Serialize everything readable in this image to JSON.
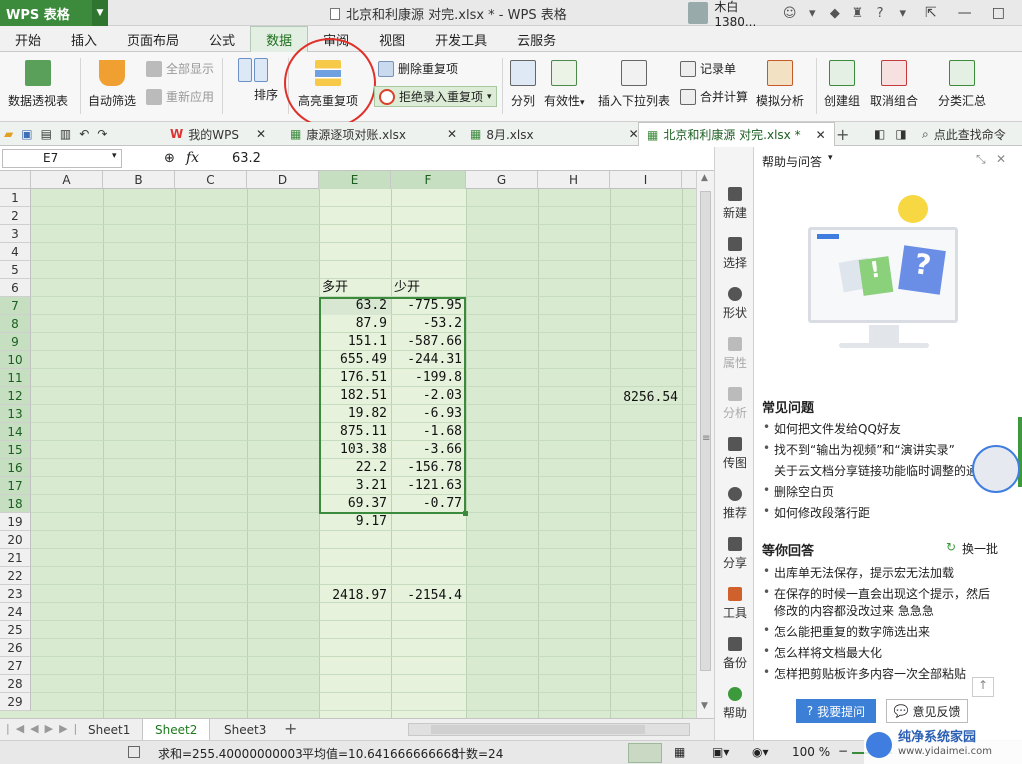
{
  "title_bar": {
    "app_label": "WPS 表格",
    "doc_title": "北京和利康源 对完.xlsx * - WPS 表格",
    "user_name": "木白1380..."
  },
  "menu_tabs": [
    "开始",
    "插入",
    "页面布局",
    "公式",
    "数据",
    "审阅",
    "视图",
    "开发工具",
    "云服务"
  ],
  "active_menu_tab": "数据",
  "ribbon": {
    "pivot": "数据透视表",
    "auto_filter": "自动筛选",
    "show_all": "全部显示",
    "reapply": "重新应用",
    "sort": "排序",
    "highlight_dup": "高亮重复项",
    "delete_dup": "删除重复项",
    "reject_dup": "拒绝录入重复项",
    "split": "分列",
    "validity": "有效性",
    "insert_dropdown": "插入下拉列表",
    "record_sheet": "记录单",
    "merge_calc": "合并计算",
    "simulate": "模拟分析",
    "create_group": "创建组",
    "cancel_group": "取消组合",
    "subtotal": "分类汇总"
  },
  "doc_tabs": {
    "my_wps": "我的WPS",
    "tab1": "康源逐项对账.xlsx",
    "tab2": "8月.xlsx",
    "tab3": "北京和利康源 对完.xlsx *",
    "search": "点此查找命令"
  },
  "formula_bar": {
    "cell_ref": "E7",
    "fx": "fx",
    "value": "63.2"
  },
  "columns": [
    "A",
    "B",
    "C",
    "D",
    "E",
    "F",
    "G",
    "H",
    "I"
  ],
  "rows": [
    "1",
    "2",
    "3",
    "4",
    "5",
    "6",
    "7",
    "8",
    "9",
    "10",
    "11",
    "12",
    "13",
    "14",
    "15",
    "16",
    "17",
    "18",
    "19",
    "20",
    "21",
    "22",
    "23",
    "24",
    "25",
    "26",
    "27",
    "28",
    "29"
  ],
  "cells": {
    "e6": "多开",
    "f6": "少开",
    "e_values": [
      "63.2",
      "87.9",
      "151.1",
      "655.49",
      "176.51",
      "182.51",
      "19.82",
      "875.11",
      "103.38",
      "22.2",
      "3.21",
      "69.37",
      "9.17"
    ],
    "f_values": [
      "-775.95",
      "-53.2",
      "-587.66",
      "-244.31",
      "-199.8",
      "-2.03",
      "-6.93",
      "-1.68",
      "-3.66",
      "-156.78",
      "-121.63",
      "-0.77"
    ],
    "i12": "8256.54",
    "e23": "2418.97",
    "f23": "-2154.4"
  },
  "sheets": [
    "Sheet1",
    "Sheet2",
    "Sheet3"
  ],
  "active_sheet": "Sheet2",
  "status": {
    "sum": "求和=255.40000000003",
    "avg": "平均值=10.641666666668",
    "count": "计数=24",
    "zoom": "100 %"
  },
  "side_tools": [
    "新建",
    "选择",
    "形状",
    "属性",
    "分析",
    "传图",
    "推荐",
    "分享",
    "工具",
    "备份",
    "帮助"
  ],
  "help_panel": {
    "title": "帮助与问答",
    "faq_title": "常见问题",
    "faq": [
      "如何把文件发给QQ好友",
      "找不到“输出为视频”和“演讲实录”",
      "关于云文档分享链接功能临时调整的通",
      "删除空白页",
      "如何修改段落行距"
    ],
    "waiting_title": "等你回答",
    "refresh": "换一批",
    "waiting": [
      "出库单无法保存，提示宏无法加载",
      "在保存的时候一直会出现这个提示，然后",
      "修改的内容都没改过来 急急急",
      "怎么能把重复的数字筛选出来",
      "怎么样将文档最大化",
      "怎样把剪贴板许多内容一次全部粘贴"
    ],
    "ask_button": "我要提问",
    "feedback_button": "意见反馈"
  },
  "watermark": {
    "line1": "纯净系统家园",
    "line2": "www.yidaimei.com"
  },
  "colors": {
    "wps_green": "#3c8a3c",
    "sheet_bg": "#d8ebd0",
    "highlight_circle": "#e0302a"
  }
}
